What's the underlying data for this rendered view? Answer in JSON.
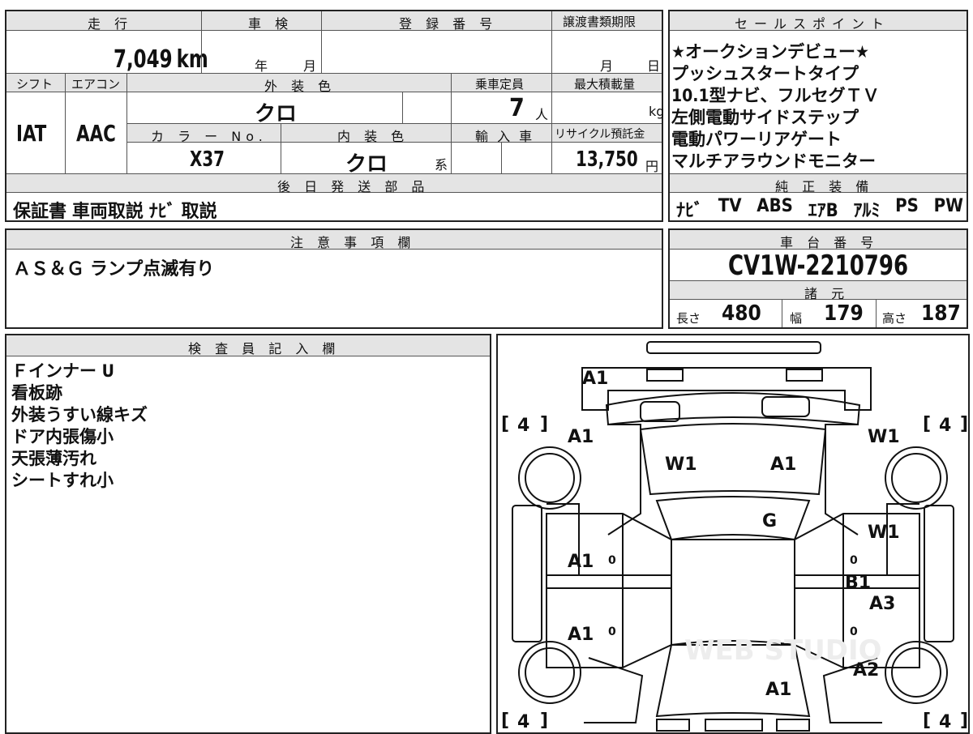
{
  "top_table": {
    "mileage_label": "走 行",
    "mileage_value": "7,049",
    "mileage_unit": "km",
    "inspection_label": "車 検",
    "inspection_year": "年",
    "inspection_month": "月",
    "registration_label": "登 録 番 号",
    "transfer_label": "譲渡書類期限",
    "transfer_month": "月",
    "transfer_day": "日",
    "shift_label": "シフト",
    "shift_value": "IAT",
    "ac_label": "エアコン",
    "ac_value": "AAC",
    "exterior_color_label": "外 装 色",
    "exterior_color_value": "クロ",
    "capacity_label": "乗車定員",
    "capacity_value": "7",
    "capacity_unit": "人",
    "max_load_label": "最大積載量",
    "max_load_unit": "kg",
    "color_no_label": "カ ラ ー No.",
    "color_no_value": "X37",
    "interior_color_label": "内 装 色",
    "interior_color_value": "クロ",
    "interior_color_suffix": "系",
    "import_label": "輸 入 車",
    "recycle_label": "リサイクル預託金",
    "recycle_value": "13,750",
    "recycle_unit": "円",
    "later_parts_label": "後 日 発 送 部 品",
    "later_parts_value": "保証書 車両取説 ﾅﾋﾞ 取説"
  },
  "sales_points": {
    "label": "セールスポイント",
    "items": [
      "★オークションデビュー★",
      "プッシュスタートタイプ",
      "10.1型ナビ、フルセグＴＶ",
      "左側電動サイドステップ",
      "電動パワーリアゲート",
      "マルチアラウンドモニター"
    ]
  },
  "genuine_equipment": {
    "label": "純 正 装 備",
    "items": [
      "ﾅﾋﾞ",
      "TV",
      "ABS",
      "ｴｱB",
      "ｱﾙﾐ",
      "PS",
      "PW"
    ]
  },
  "notes": {
    "label": "注 意 事 項 欄",
    "value": "ＡＳ＆Ｇ ランプ点滅有り"
  },
  "chassis": {
    "label": "車 台 番 号",
    "value": "CV1W-2210796",
    "specs_label": "諸 元",
    "length_label": "長さ",
    "length_value": "480",
    "width_label": "幅",
    "width_value": "179",
    "height_label": "高さ",
    "height_value": "187"
  },
  "inspector": {
    "label": "検 査 員 記 入 欄",
    "lines": [
      "Ｆインナー U",
      "看板跡",
      "外装うすい線キズ",
      "ドア内張傷小",
      "天張薄汚れ",
      "シートすれ小"
    ]
  },
  "diagram": {
    "marks": {
      "rear_top": "A1",
      "left_front_fender": "A1",
      "right_front_fender": "W1",
      "hood_left": "W1",
      "hood_right": "A1",
      "windshield": "G",
      "right_front_door": "W1",
      "left_front_door": "A1",
      "left_rear_door": "A1",
      "right_b_pillar": "B1",
      "right_rear_door": "A3",
      "right_rear_quarter": "A2",
      "roof_rear": "A1"
    },
    "door_zero": "0",
    "tire_values": [
      "4",
      "4",
      "4",
      "4"
    ],
    "watermark": "WEB STUDIO"
  }
}
